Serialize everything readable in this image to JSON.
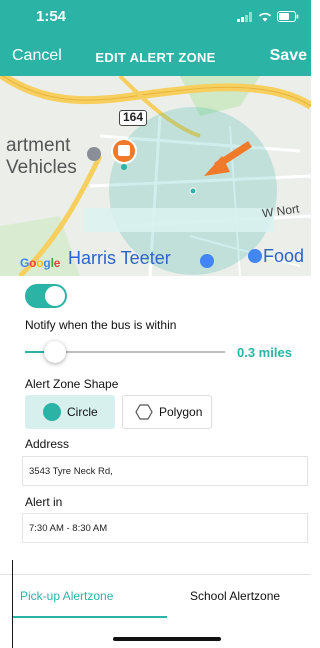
{
  "status_bar": {
    "time": "1:54"
  },
  "nav": {
    "cancel_label": "Cancel",
    "title": "EDIT ALERT ZONE",
    "save_label": "Save"
  },
  "map": {
    "route_number": "164",
    "place_label_line1": "artment",
    "place_label_line2": "Vehicles",
    "road_label": "W Nort",
    "store_label": "Harris Teeter",
    "food_label": "Food",
    "attribution": [
      "G",
      "o",
      "o",
      "g",
      "l",
      "e"
    ]
  },
  "alert": {
    "enabled": true,
    "notify_label": "Notify when the bus is within",
    "distance_value": "0.3 miles",
    "distance_fraction": 0.15,
    "shape_label": "Alert Zone Shape",
    "shape_options": [
      {
        "label": "Circle",
        "selected": true
      },
      {
        "label": "Polygon",
        "selected": false
      }
    ],
    "address_label": "Address",
    "address_value": "3543 Tyre Neck Rd,",
    "alert_in_label": "Alert in",
    "alert_in_value": "7:30 AM - 8:30 AM"
  },
  "tabs": [
    {
      "label": "Pick-up Alertzone",
      "active": true
    },
    {
      "label": "School Alertzone",
      "active": false
    }
  ],
  "colors": {
    "accent": "#2bb3a6",
    "arrow": "#f07a2a",
    "link_blue": "#2e64c9"
  }
}
